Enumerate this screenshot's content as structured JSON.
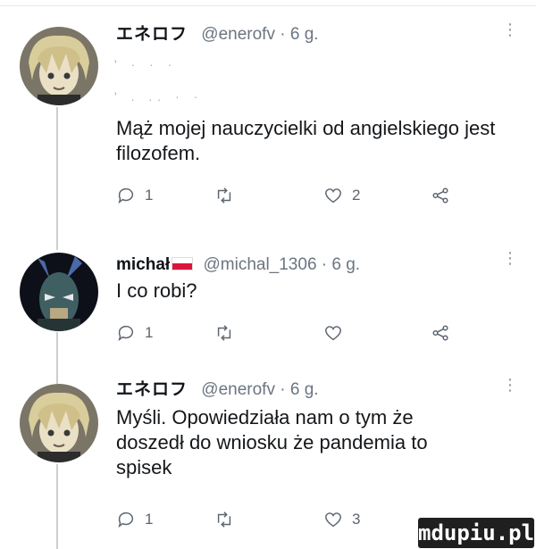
{
  "tweets": [
    {
      "name": "エネロフ",
      "handle": "@enerofv · 6 g.",
      "faint_text_1": "' · · ·",
      "faint_text_2": "' . .. · ·",
      "text": "Mąż mojej nauczycielki od angielskiego jest filozofem.",
      "replies": "1",
      "retweets": "",
      "likes": "2"
    },
    {
      "name": "michał",
      "flag": "poland-flag",
      "handle": "@michal_1306 · 6 g.",
      "text": "I co robi?",
      "replies": "1",
      "retweets": "",
      "likes": ""
    },
    {
      "name": "エネロフ",
      "handle": "@enerofv · 6 g.",
      "text": "Myśli. Opowiedziała nam o tym że doszedł do wniosku że pandemia to spisek",
      "replies": "1",
      "retweets": "",
      "likes": "3"
    }
  ],
  "icons": [
    "comment-icon",
    "retweet-icon",
    "heart-icon",
    "share-icon",
    "more-icon"
  ],
  "colors": {
    "text": "#14171a",
    "muted": "#6b7580",
    "thread": "#c9cfd4",
    "flag_red": "#dc143c"
  },
  "watermark": "mdupiu.pl"
}
